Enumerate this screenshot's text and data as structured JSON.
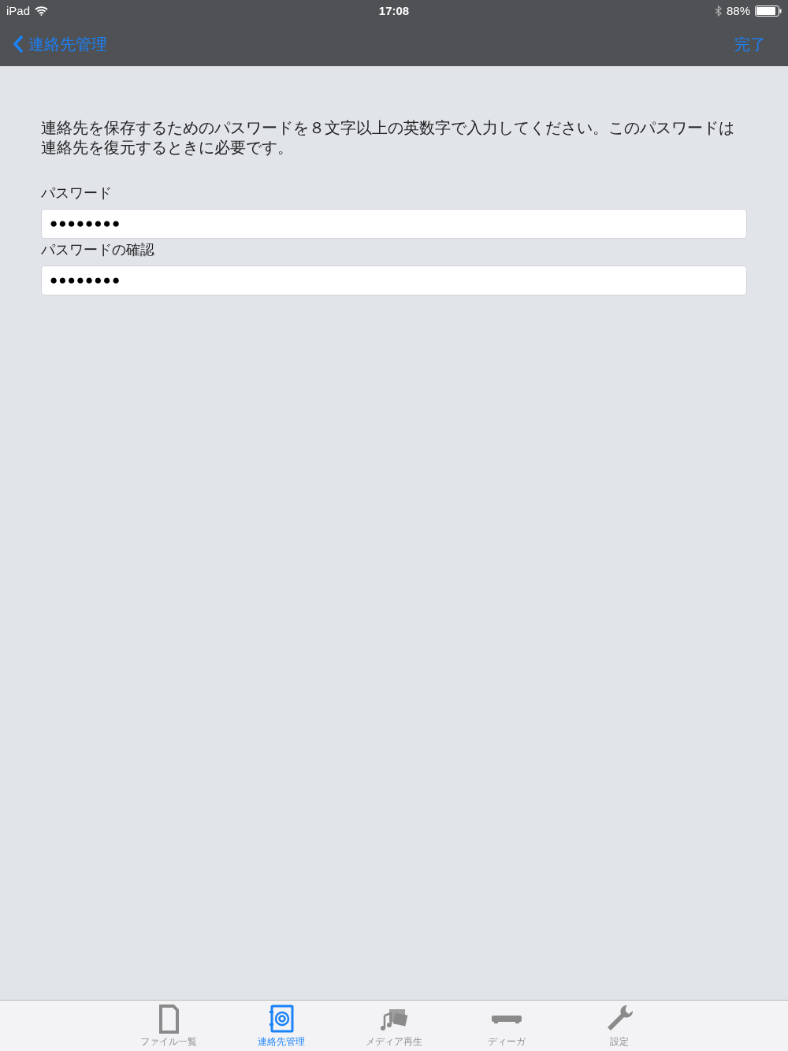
{
  "status_bar": {
    "device": "iPad",
    "time": "17:08",
    "battery": "88%"
  },
  "nav": {
    "back": "連絡先管理",
    "done": "完了"
  },
  "instructions": "連絡先を保存するためのパスワードを８文字以上の英数字で入力してください。このパスワードは連絡先を復元するときに必要です。",
  "fields": [
    {
      "label": "パスワード",
      "value": "●●●●●●●●"
    },
    {
      "label": "パスワードの確認",
      "value": "●●●●●●●●"
    }
  ],
  "tabs": [
    {
      "label": "ファイル一覧",
      "selected": false
    },
    {
      "label": "連絡先管理",
      "selected": true
    },
    {
      "label": "メディア再生",
      "selected": false
    },
    {
      "label": "ディーガ",
      "selected": false
    },
    {
      "label": "設定",
      "selected": false
    }
  ]
}
